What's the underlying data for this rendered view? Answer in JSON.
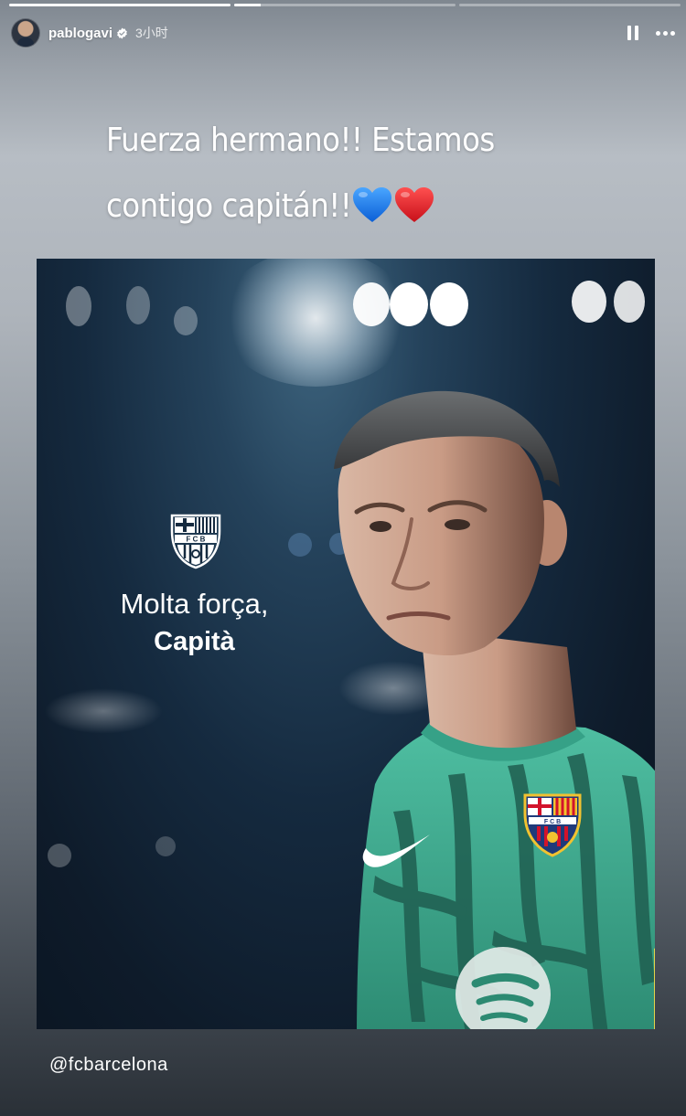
{
  "story": {
    "progress": [
      1.0,
      0.12,
      0.0
    ],
    "header": {
      "username": "pablogavi",
      "time": "3小时",
      "avatar_icon": "user-avatar",
      "verified_icon": "verified-badge-icon",
      "pause_icon": "pause-icon",
      "more_icon": "more-options-icon"
    },
    "caption": {
      "line1": "Fuerza hermano!! Estamos",
      "line2": "contigo capitán!!",
      "emoji": [
        "blue-heart",
        "red-heart"
      ]
    },
    "poster": {
      "crest_icon": "fc-barcelona-crest",
      "text_line1": "Molta força,",
      "text_line2": "Capità",
      "subject": "goalkeeper in green kit"
    },
    "mention": "@fcbarcelona"
  },
  "colors": {
    "heart_blue": "#1a7bf0",
    "heart_red": "#e0202a",
    "kit_green": "#3aa58a"
  }
}
